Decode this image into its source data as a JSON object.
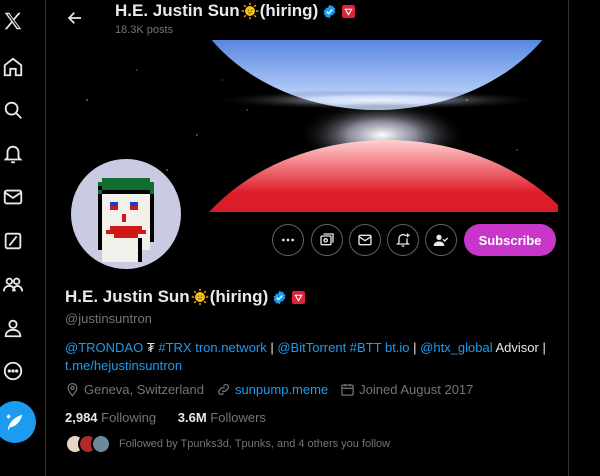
{
  "header": {
    "name_start": "H.E. Justin Sun",
    "name_end": "(hiring)",
    "post_count": "18.3K posts"
  },
  "profile": {
    "name_start": "H.E. Justin Sun",
    "name_end": "(hiring)",
    "handle": "@justinsuntron",
    "bio": {
      "link1": "@TRONDAO",
      "symbol": " ₮ ",
      "link2": "#TRX tron.network",
      "sep1": " | ",
      "link3": "@BitTorrent #BTT bt.io",
      "sep2": " | ",
      "link4": "@htx_global",
      "text1": " Advisor |",
      "link5": "t.me/hejustinsuntron"
    },
    "location": "Geneva, Switzerland",
    "website": "sunpump.meme",
    "joined": "Joined August 2017",
    "following_count": "2,984",
    "following_label": "Following",
    "followers_count": "3.6M",
    "followers_label": "Followers",
    "followed_by": "Followed by Tpunks3d, Tpunks, and 4 others you follow"
  },
  "actions": {
    "subscribe_label": "Subscribe"
  },
  "icons": {
    "nav": [
      "x-logo-icon",
      "home-icon",
      "search-icon",
      "notifications-icon",
      "messages-icon",
      "grok-icon",
      "communities-icon",
      "profile-icon",
      "more-icon",
      "compose-icon"
    ],
    "actions": [
      "more-options-icon",
      "grok-icon",
      "message-icon",
      "notify-icon",
      "follow-icon"
    ]
  },
  "colors": {
    "accent": "#1d9bf0",
    "subscribe": "#c936cc",
    "bg": "#000000",
    "muted": "#71767b"
  }
}
